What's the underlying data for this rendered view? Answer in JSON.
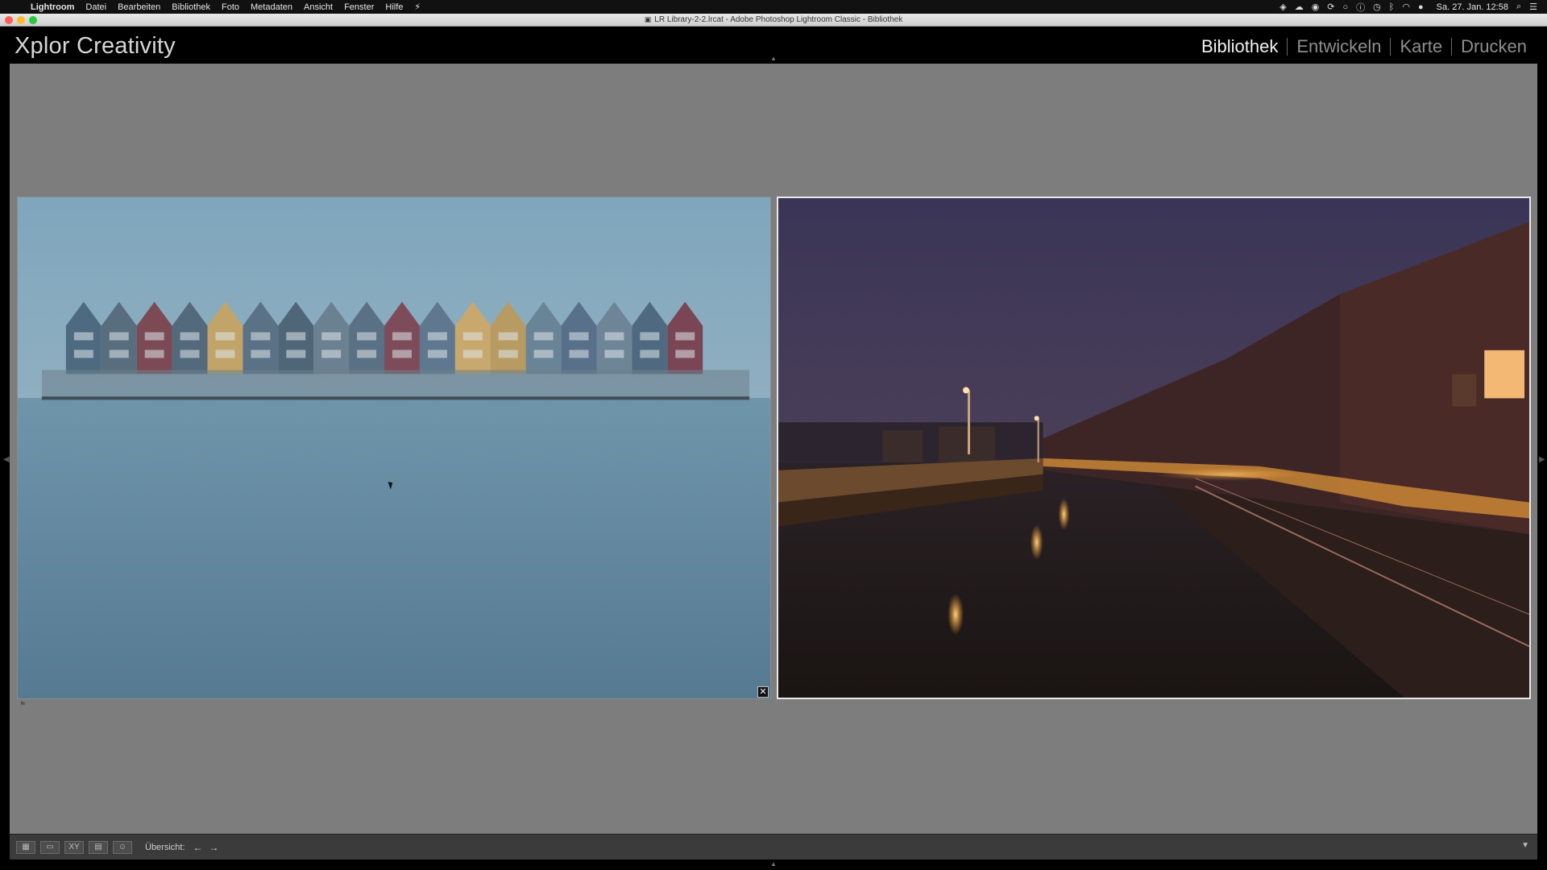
{
  "menubar": {
    "apple": "",
    "items": [
      "Lightroom",
      "Datei",
      "Bearbeiten",
      "Bibliothek",
      "Foto",
      "Metadaten",
      "Ansicht",
      "Fenster",
      "Hilfe"
    ],
    "status_icons": [
      "bolt-icon",
      "dropbox-icon",
      "cloud-icon",
      "record-icon",
      "sync-icon",
      "wifi-icon",
      "bluetooth-icon",
      "time-machine-icon",
      "user-icon"
    ],
    "clock": "Sa. 27. Jan. 12:58"
  },
  "window": {
    "title": "LR Library-2-2.lrcat - Adobe Photoshop Lightroom Classic - Bibliothek"
  },
  "identity_plate": "Xplor Creativity",
  "modules": [
    "Bibliothek",
    "Entwickeln",
    "Karte",
    "Drucken"
  ],
  "active_module": "Bibliothek",
  "compare": {
    "left_photo_alt": "",
    "right_photo_alt": "",
    "close_glyph": "✕"
  },
  "toolbar": {
    "view_buttons": [
      "grid-view",
      "loupe-view",
      "compare-view",
      "survey-view",
      "people-view"
    ],
    "survey_label": "Übersicht:",
    "prev_arrow": "←",
    "next_arrow": "→"
  },
  "colors": {
    "canvas": "#7d7d7d",
    "toolbar": "#3b3b3b",
    "module_active": "#f2f2f2",
    "module_inactive": "#8e8e8e"
  }
}
